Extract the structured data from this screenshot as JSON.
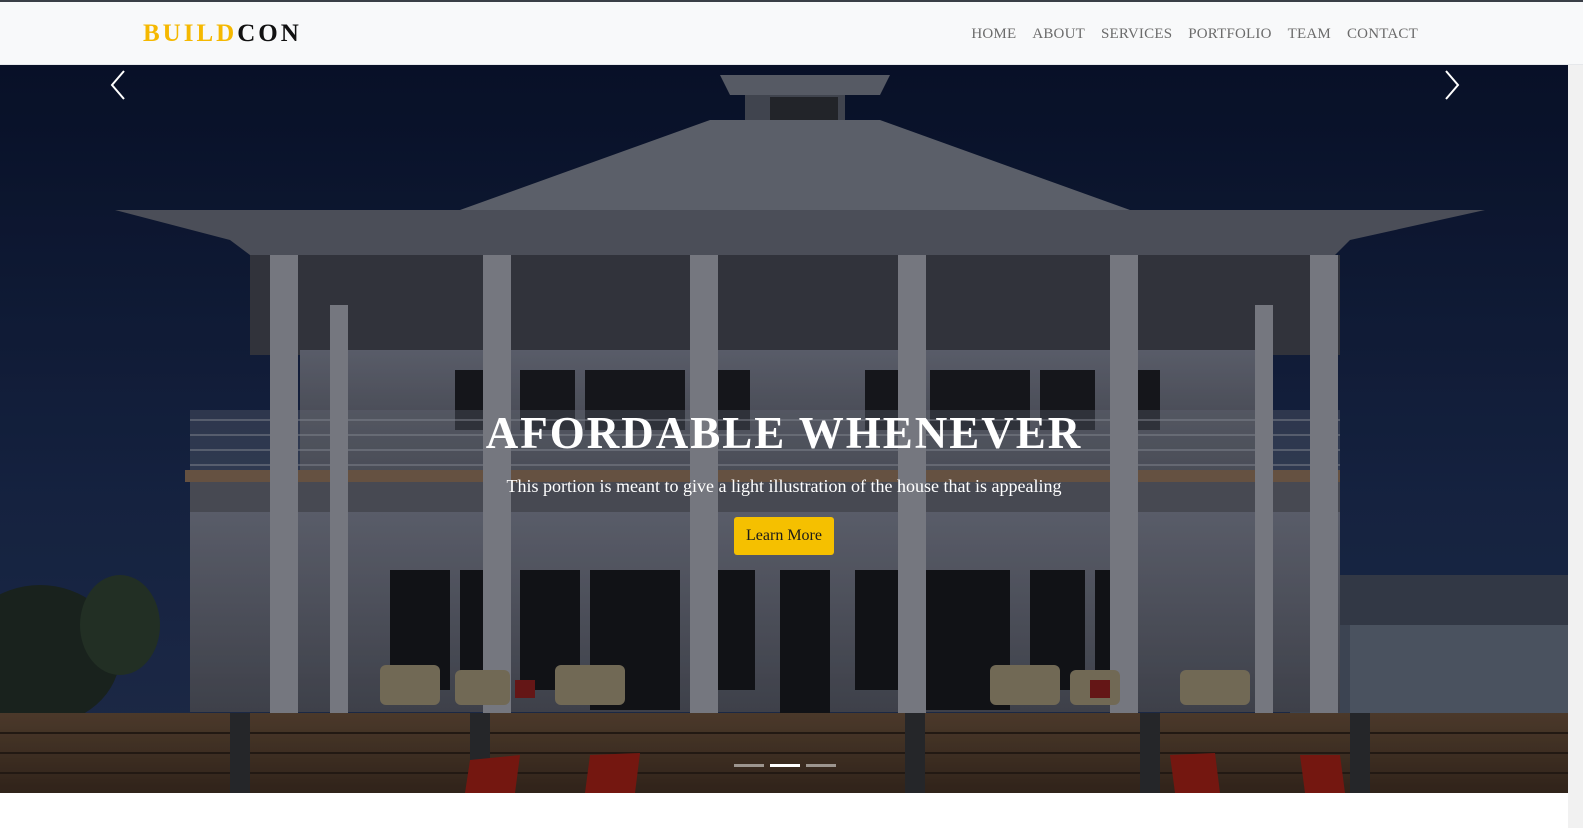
{
  "brand": {
    "part1": "BUILD",
    "part2": "CON"
  },
  "nav": {
    "items": [
      "HOME",
      "ABOUT",
      "SERVICES",
      "PORTFOLIO",
      "TEAM",
      "CONTACT"
    ]
  },
  "hero": {
    "title": "AFORDABLE WHENEVER",
    "subtitle": "This portion is meant to give a light illustration of the house that is appealing",
    "button_label": "Learn More",
    "active_slide": 2,
    "slide_count": 3
  },
  "icons": {
    "prev": "chevron-left-icon",
    "next": "chevron-right-icon"
  },
  "colors": {
    "accent": "#f5c000",
    "navbar_bg": "#f8f9fa",
    "sky": "#0d1730"
  }
}
